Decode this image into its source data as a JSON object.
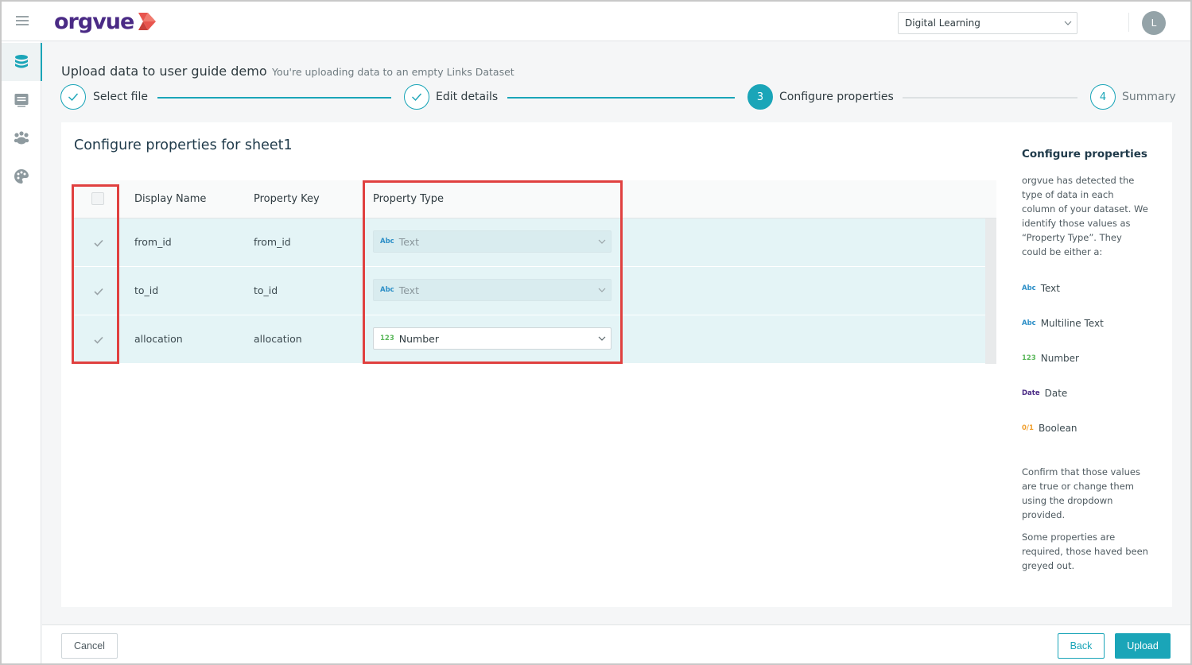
{
  "app": {
    "logo_text": "orgvue",
    "workspace": "Digital Learning",
    "avatar_initial": "L",
    "accent_color": "#1aa5b8",
    "brand_color": "#4a2a85"
  },
  "sidebar": {
    "items": [
      {
        "icon": "database-icon"
      },
      {
        "icon": "list-panel-icon"
      },
      {
        "icon": "paw-icon"
      },
      {
        "icon": "palette-icon"
      }
    ]
  },
  "header": {
    "title": "Upload data to user guide demo",
    "subtitle": "You're uploading data to an empty Links Dataset"
  },
  "stepper": {
    "steps": [
      {
        "label": "Select file",
        "status": "done"
      },
      {
        "label": "Edit details",
        "status": "done"
      },
      {
        "label": "Configure properties",
        "number": "3",
        "status": "active"
      },
      {
        "label": "Summary",
        "number": "4",
        "status": "pending"
      }
    ]
  },
  "main": {
    "title": "Configure properties for sheet1",
    "columns": {
      "display_name": "Display Name",
      "property_key": "Property Key",
      "property_type": "Property Type"
    },
    "rows": [
      {
        "display_name": "from_id",
        "property_key": "from_id",
        "type_tag": "Abc",
        "type_label": "Text",
        "checked": true,
        "enabled": false
      },
      {
        "display_name": "to_id",
        "property_key": "to_id",
        "type_tag": "Abc",
        "type_label": "Text",
        "checked": true,
        "enabled": false
      },
      {
        "display_name": "allocation",
        "property_key": "allocation",
        "type_tag": "123",
        "type_label": "Number",
        "checked": true,
        "enabled": true
      }
    ]
  },
  "help": {
    "title": "Configure properties",
    "intro": "orgvue has detected the type of data in each column of your dataset. We identify those values as “Property Type”. They could be either a:",
    "types": [
      {
        "tag": "Abc",
        "label": "Text"
      },
      {
        "tag": "Abc",
        "label": "Multiline Text"
      },
      {
        "tag": "123",
        "label": "Number"
      },
      {
        "tag": "Date",
        "label": "Date"
      },
      {
        "tag": "0/1",
        "label": "Boolean"
      }
    ],
    "confirm": "Confirm that those values are true or change them using the dropdown provided.",
    "required_note": "Some properties are required, those haved been greyed out."
  },
  "footer": {
    "cancel": "Cancel",
    "back": "Back",
    "upload": "Upload"
  }
}
